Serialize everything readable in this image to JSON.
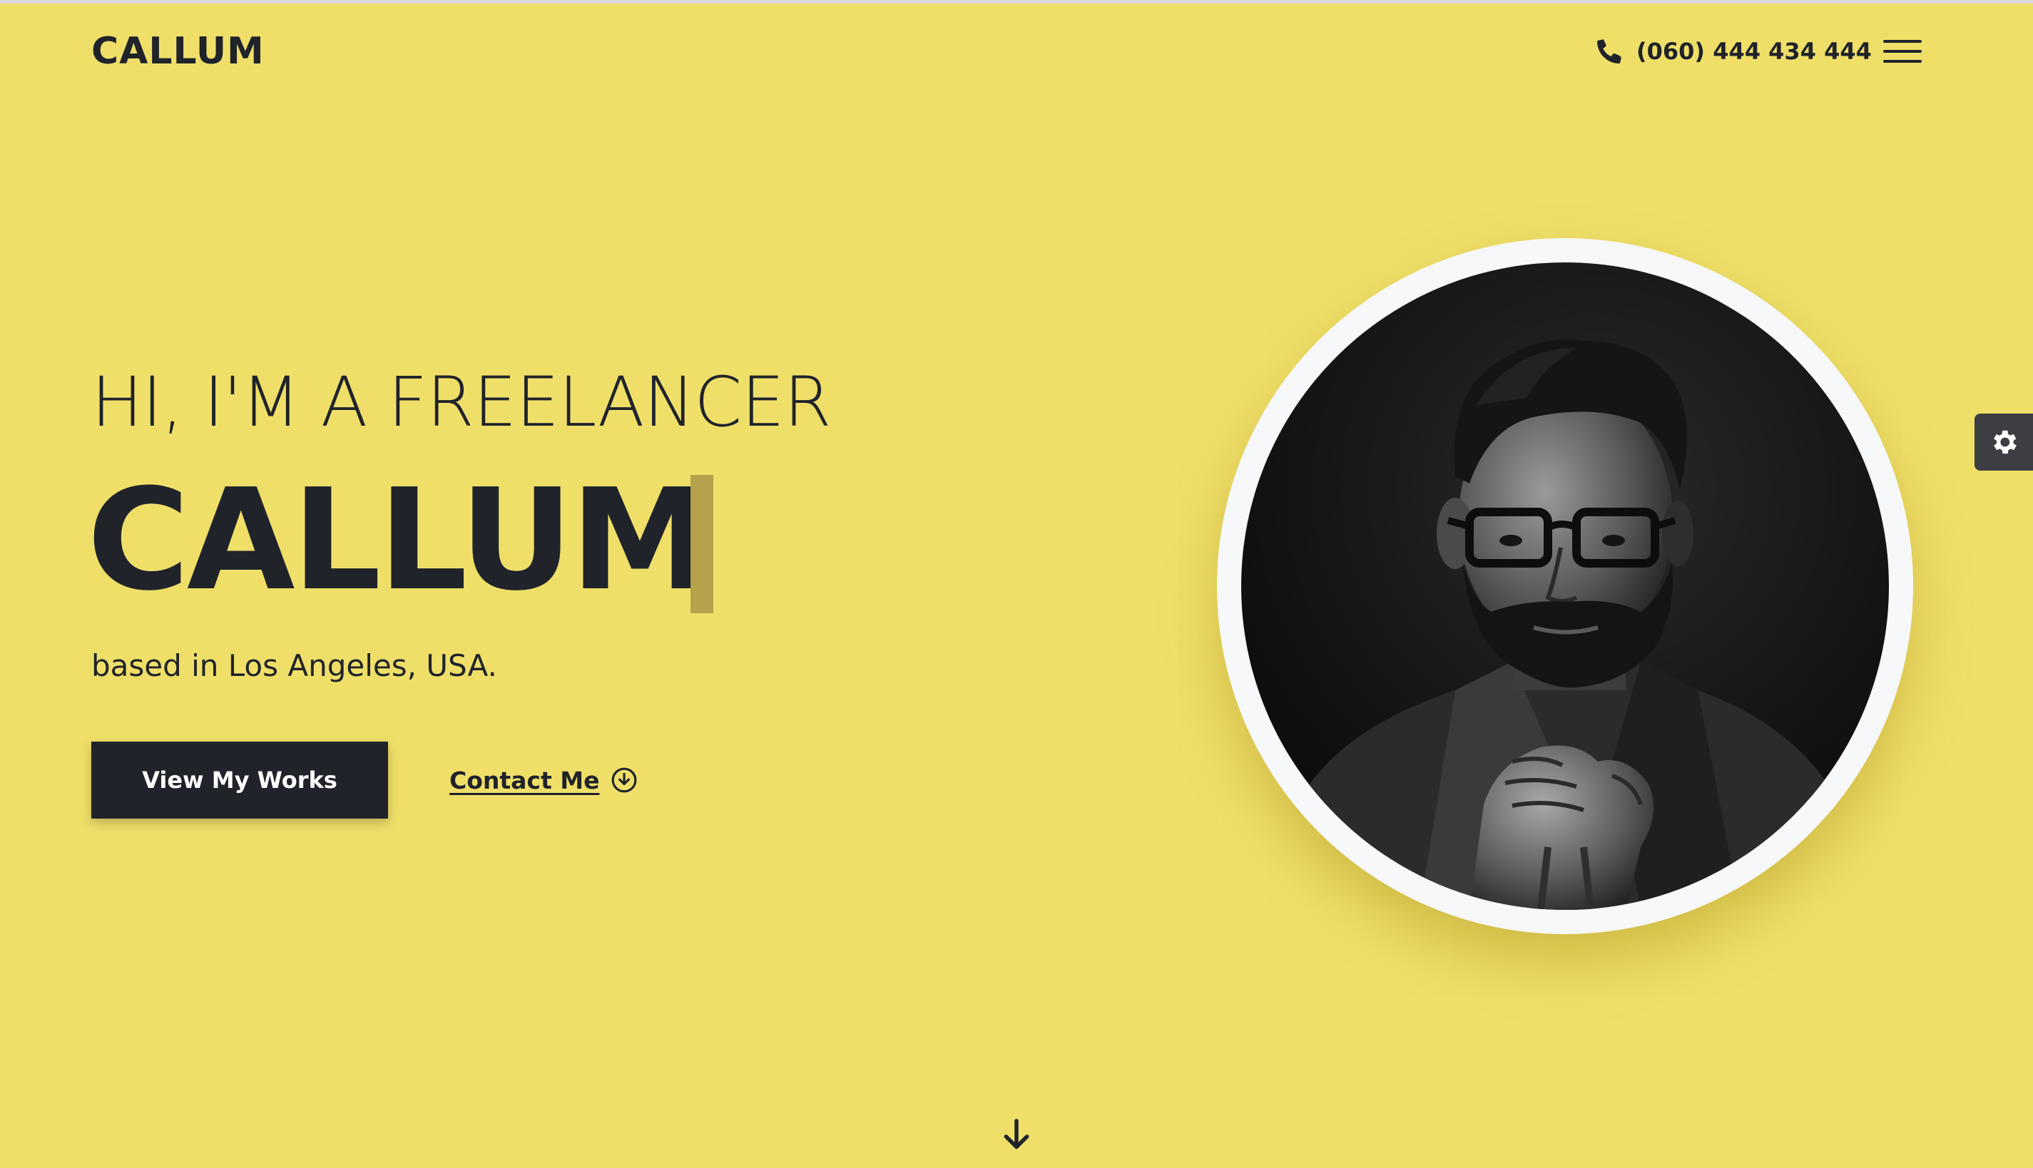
{
  "header": {
    "logo": "CALLUM",
    "phone": "(060) 444 434 444",
    "phone_icon": "phone-icon",
    "menu_icon": "hamburger-menu-icon"
  },
  "hero": {
    "subtitle": "HI, I'M A FREELANCER",
    "name": "CALLUM",
    "location": "based in Los Angeles, USA.",
    "primary_button": "View My Works",
    "secondary_link": "Contact Me",
    "secondary_icon": "arrow-down-circle-icon",
    "portrait_alt": "Portrait photo"
  },
  "side": {
    "settings_icon": "gear-icon"
  },
  "scroll": {
    "icon": "arrow-down-icon"
  },
  "colors": {
    "background": "#efdf69",
    "text": "#20232a",
    "button_bg": "#20232a",
    "button_text": "#ffffff",
    "cursor_bar": "#b6a24c",
    "portrait_ring": "#f7f8fa"
  }
}
